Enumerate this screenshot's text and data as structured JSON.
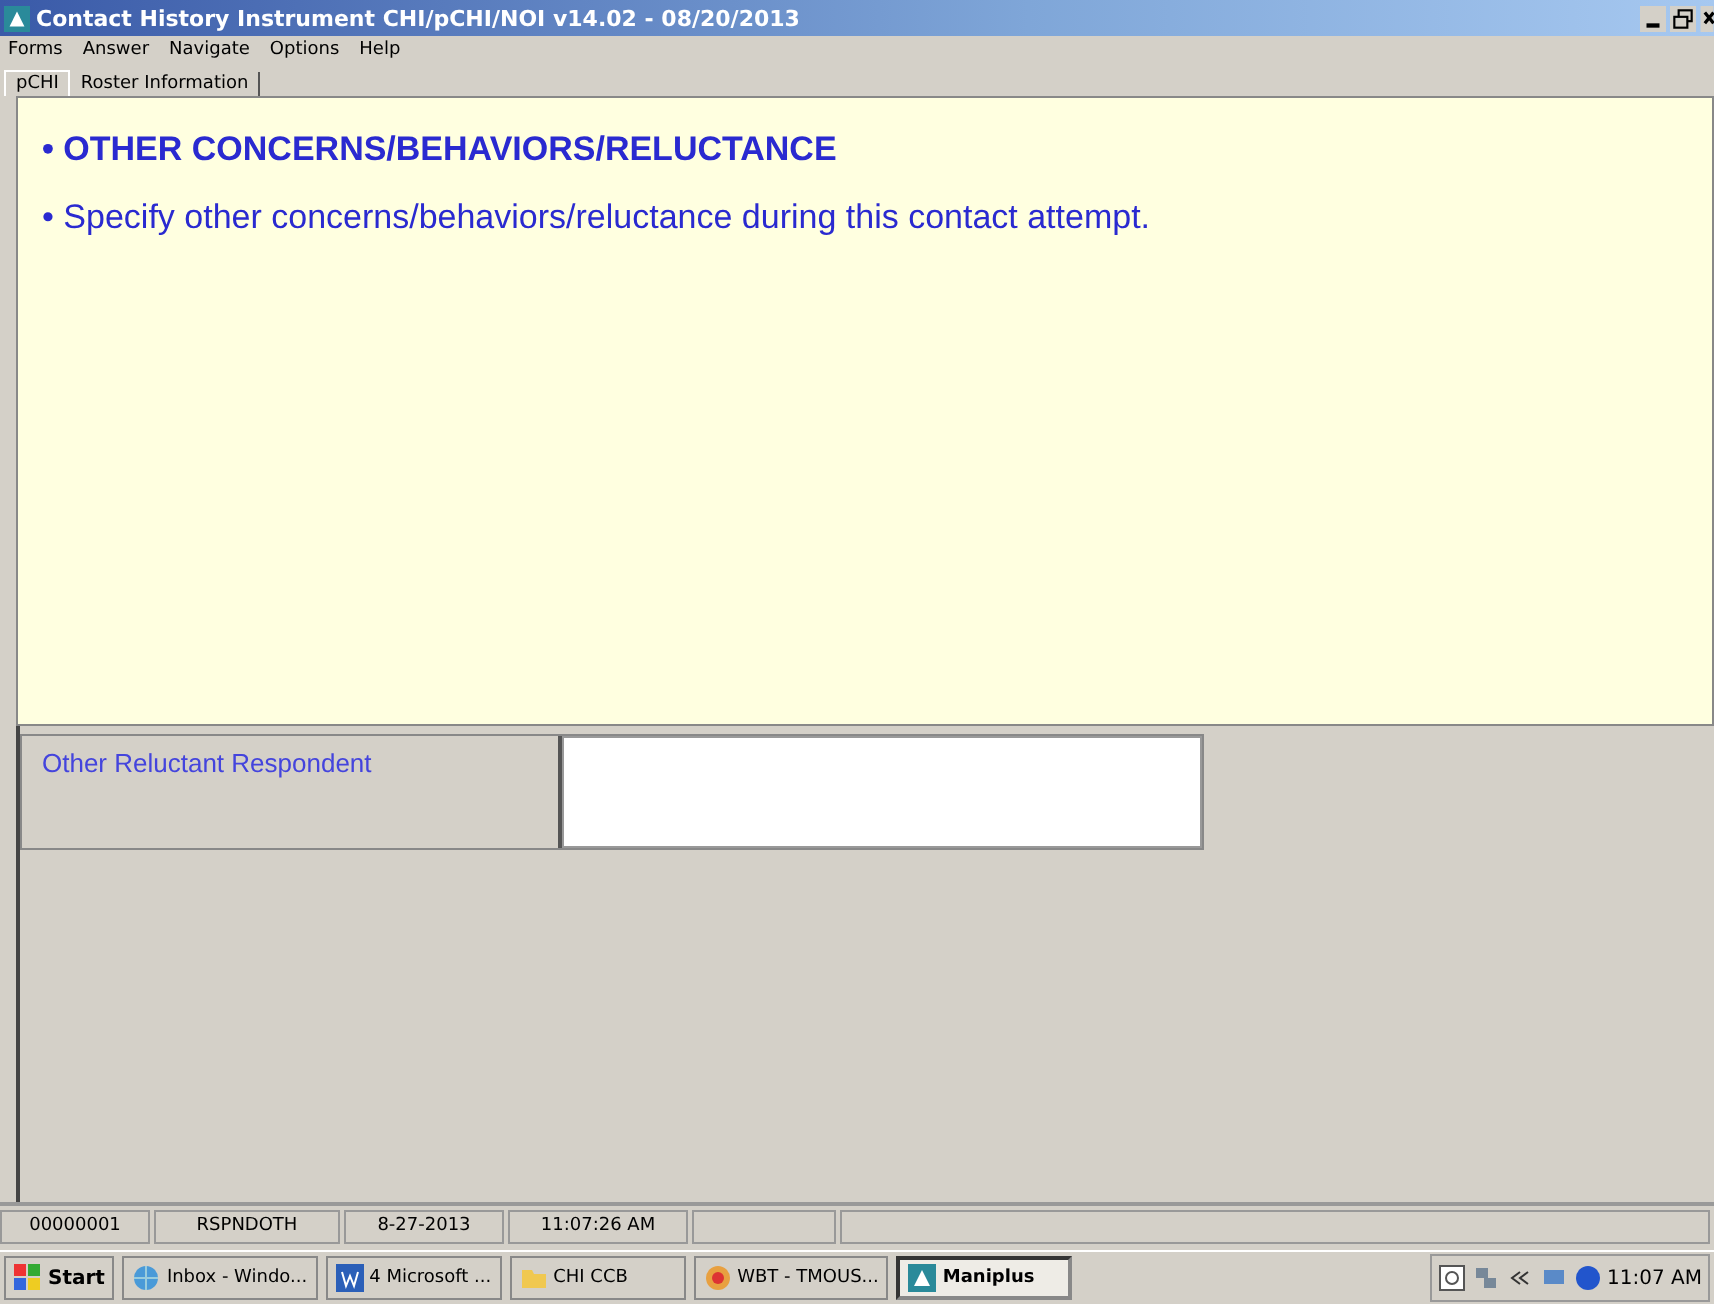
{
  "window": {
    "title": "Contact History Instrument CHI/pCHI/NOI v14.02 - 08/20/2013"
  },
  "menu": [
    "Forms",
    "Answer",
    "Navigate",
    "Options",
    "Help"
  ],
  "tabs": [
    {
      "label": "pCHI",
      "selected": true
    },
    {
      "label": "Roster Information",
      "selected": false
    }
  ],
  "question": {
    "bullets": [
      {
        "text": "• OTHER CONCERNS/BEHAVIORS/RELUCTANCE",
        "bold": true
      },
      {
        "text": "• Specify other concerns/behaviors/reluctance during this contact attempt.",
        "bold": false
      }
    ]
  },
  "answer": {
    "label": "Other Reluctant Respondent"
  },
  "status_bar": [
    "00000001",
    "RSPNDOTH",
    "8-27-2013",
    "11:07:26 AM"
  ],
  "taskbar": {
    "start": "Start",
    "buttons": [
      {
        "label": "Inbox - Windo...",
        "selected": false
      },
      {
        "label": "4 Microsoft ...",
        "selected": false
      },
      {
        "label": "CHI CCB",
        "selected": false
      },
      {
        "label": "WBT - TMOUS...",
        "selected": false
      },
      {
        "label": "Maniplus",
        "selected": true
      }
    ],
    "clock": "11:07 AM"
  }
}
